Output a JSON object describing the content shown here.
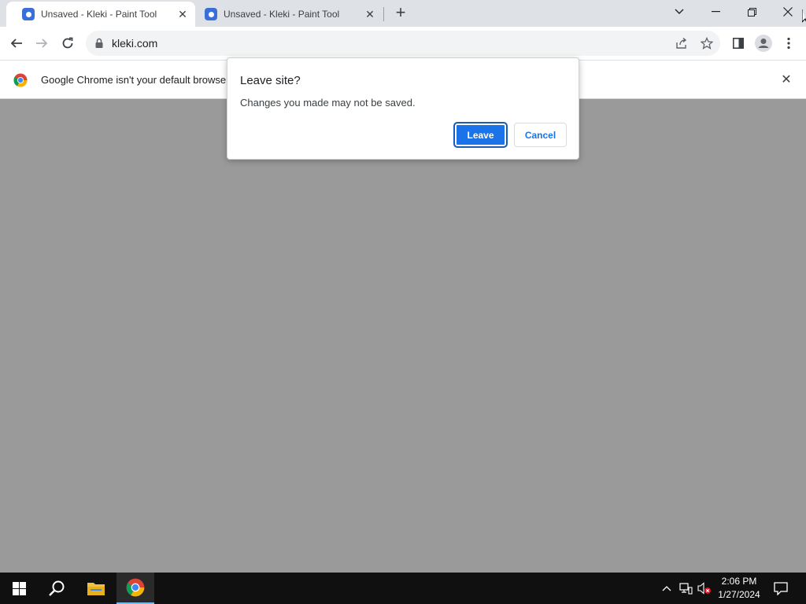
{
  "tabs": [
    {
      "title": "Unsaved - Kleki - Paint Tool",
      "active": true
    },
    {
      "title": "Unsaved - Kleki - Paint Tool",
      "active": false
    }
  ],
  "tab_close_glyph": "✕",
  "new_tab_glyph": "+",
  "window_controls": {
    "list": "⌄",
    "minimize": "—",
    "restore": "❐",
    "close": "✕"
  },
  "address_bar": {
    "url": "kleki.com"
  },
  "infobar": {
    "message": "Google Chrome isn't your default browse",
    "close_glyph": "✕"
  },
  "dialog": {
    "title": "Leave site?",
    "message": "Changes you made may not be saved.",
    "leave_label": "Leave",
    "cancel_label": "Cancel"
  },
  "taskbar": {
    "time": "2:06 PM",
    "date": "1/27/2024"
  },
  "colors": {
    "accent": "#1a73e8",
    "tabstrip": "#dee1e6",
    "content_bg": "#9a9a9a",
    "taskbar": "#101010"
  },
  "icons": [
    "kleki-favicon",
    "back-arrow-icon",
    "forward-arrow-icon",
    "reload-icon",
    "lock-icon",
    "share-icon",
    "bookmark-star-icon",
    "side-panel-icon",
    "profile-icon",
    "menu-kebab-icon",
    "chrome-logo-icon",
    "windows-start-icon",
    "search-icon",
    "file-explorer-icon",
    "chrome-taskbar-icon",
    "chevron-up-icon",
    "network-icon",
    "volume-muted-icon",
    "notification-icon"
  ]
}
